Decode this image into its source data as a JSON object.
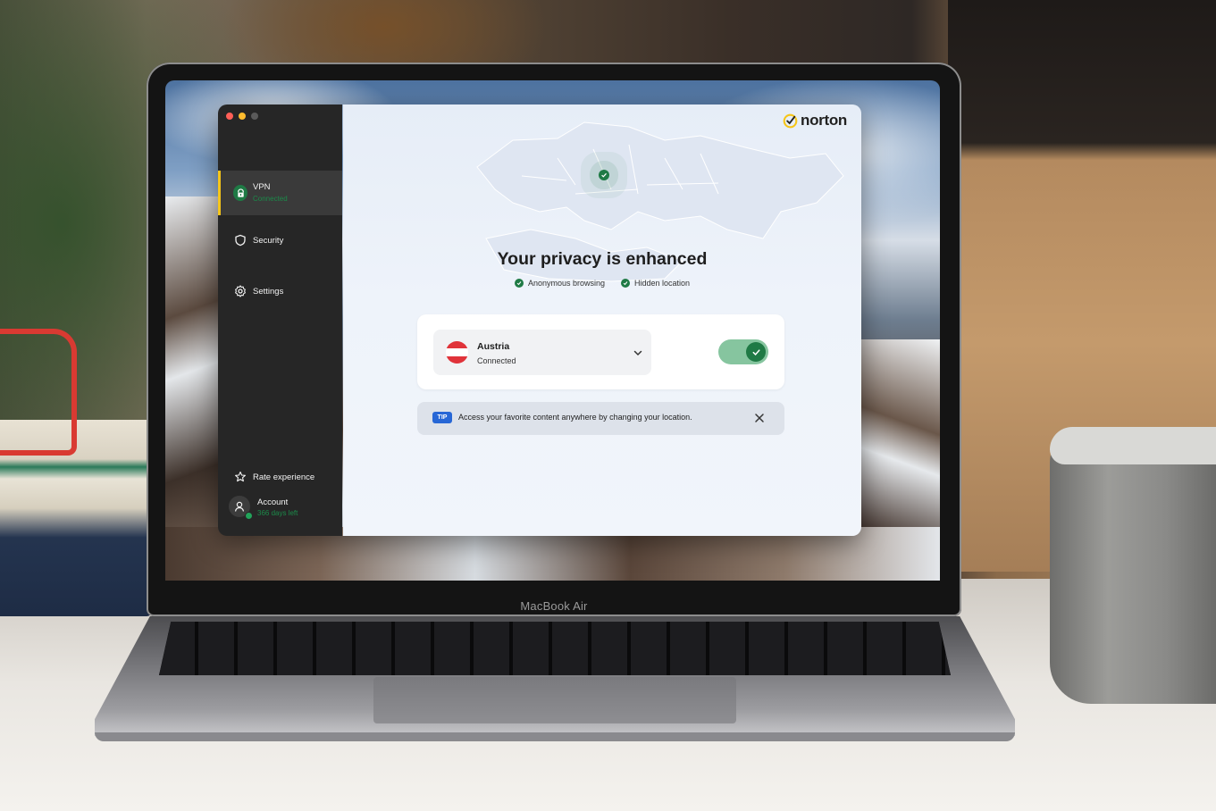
{
  "window": {
    "title": "Norton VPN"
  },
  "device": {
    "model_label": "MacBook Air"
  },
  "sidebar": {
    "items": [
      {
        "label": "VPN",
        "sublabel": "Connected",
        "icon": "vpn-icon",
        "active": true
      },
      {
        "label": "Security",
        "icon": "shield-icon",
        "active": false
      },
      {
        "label": "Settings",
        "icon": "gear-icon",
        "active": false
      }
    ],
    "rate_label": "Rate experience",
    "account_label": "Account",
    "account_sub": "366 days left"
  },
  "brand": {
    "name": "norton",
    "accent": "#f5c518"
  },
  "main": {
    "headline": "Your privacy is enhanced",
    "features": [
      "Anonymous browsing",
      "Hidden location"
    ],
    "location": {
      "country": "Austria",
      "status": "Connected",
      "flag_colors": [
        "#e0333a",
        "#ffffff",
        "#e0333a"
      ]
    },
    "vpn_toggle_on": true,
    "tip": {
      "badge": "TIP",
      "text": "Access your favorite content anywhere by changing your location."
    }
  },
  "colors": {
    "sidebar_bg": "#262626",
    "active_item_bg": "#3a3a3a",
    "success_green": "#1f7a45",
    "toggle_track": "#86c59f",
    "tip_badge": "#2767d6"
  }
}
